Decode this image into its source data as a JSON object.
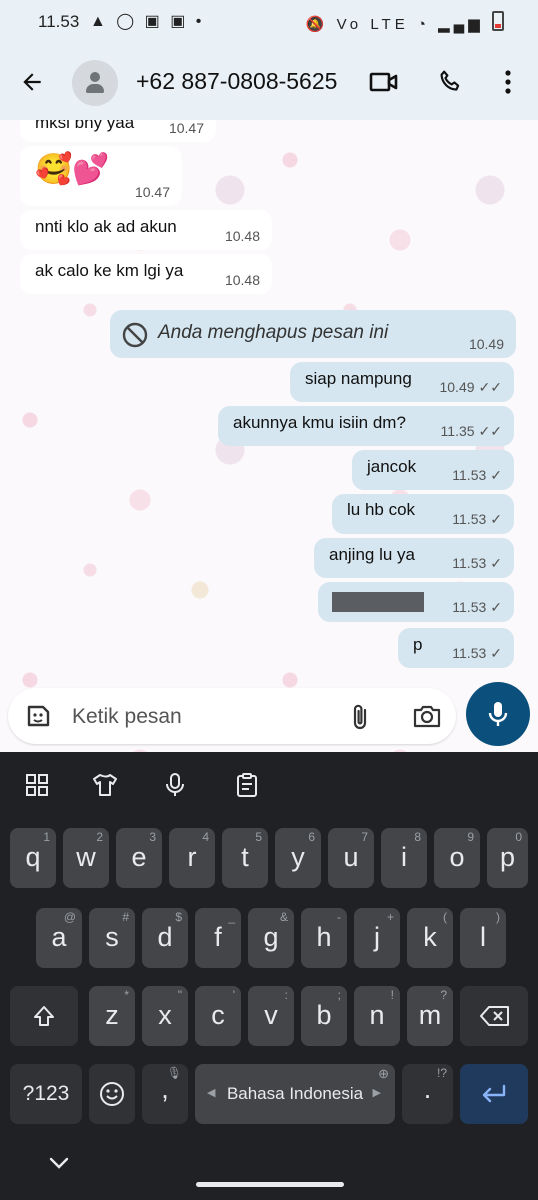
{
  "status_bar": {
    "time": "11.53",
    "left_icons": "▲ ◯ ▣ ▣ •",
    "right_icons": "🔕 Vo LTE"
  },
  "header": {
    "contact": "+62 887-0808-5625"
  },
  "messages": [
    {
      "text": "mksi bny yaa",
      "time": "10.47",
      "direction": "in"
    },
    {
      "text": "🥰💕",
      "time": "10.47",
      "direction": "in"
    },
    {
      "text": "nnti klo ak ad akun",
      "time": "10.48",
      "direction": "in"
    },
    {
      "text": "ak calo ke km lgi ya",
      "time": "10.48",
      "direction": "in"
    },
    {
      "text": "Anda menghapus pesan ini",
      "time": "10.49",
      "direction": "out",
      "deleted": true
    },
    {
      "text": "siap nampung",
      "time": "10.49",
      "direction": "out",
      "status": "read"
    },
    {
      "text": "akunnya kmu isiin dm?",
      "time": "11.35",
      "direction": "out",
      "status": "read"
    },
    {
      "text": "jancok",
      "time": "11.53",
      "direction": "out",
      "status": "sent"
    },
    {
      "text": "lu hb cok",
      "time": "11.53",
      "direction": "out",
      "status": "sent"
    },
    {
      "text": "anjing lu ya",
      "time": "11.53",
      "direction": "out",
      "status": "sent"
    },
    {
      "text": "",
      "time": "11.53",
      "direction": "out",
      "status": "sent",
      "redacted": true
    },
    {
      "text": "p",
      "time": "11.53",
      "direction": "out",
      "status": "sent"
    }
  ],
  "composer": {
    "placeholder": "Ketik pesan"
  },
  "keyboard": {
    "row1": [
      [
        "q",
        "1"
      ],
      [
        "w",
        "2"
      ],
      [
        "e",
        "3"
      ],
      [
        "r",
        "4"
      ],
      [
        "t",
        "5"
      ],
      [
        "y",
        "6"
      ],
      [
        "u",
        "7"
      ],
      [
        "i",
        "8"
      ],
      [
        "o",
        "9"
      ],
      [
        "p",
        "0"
      ]
    ],
    "row2": [
      [
        "a",
        "@"
      ],
      [
        "s",
        "#"
      ],
      [
        "d",
        "$"
      ],
      [
        "f",
        "_"
      ],
      [
        "g",
        "&"
      ],
      [
        "h",
        "-"
      ],
      [
        "j",
        "+"
      ],
      [
        "k",
        "("
      ],
      [
        "l",
        ")"
      ]
    ],
    "row3": [
      [
        "z",
        "*"
      ],
      [
        "x",
        "\""
      ],
      [
        "c",
        "'"
      ],
      [
        "v",
        ":"
      ],
      [
        "b",
        ";"
      ],
      [
        "n",
        "!"
      ],
      [
        "m",
        "?"
      ]
    ],
    "symbols_label": "?123",
    "comma_label": ",",
    "period_label": ".",
    "period_hint": "!?",
    "space_label": "Bahasa Indonesia"
  },
  "colors": {
    "outgoing_bubble": "#d5e6f0",
    "incoming_bubble": "#ffffff",
    "accent": "#0b4f7c"
  }
}
